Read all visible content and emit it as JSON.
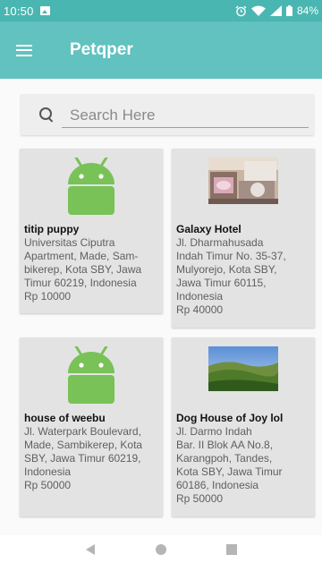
{
  "status_bar": {
    "time": "10:50",
    "battery": "84%"
  },
  "app_bar": {
    "title": "Petqper"
  },
  "search": {
    "placeholder": "Search Here"
  },
  "listings": [
    {
      "name": "titip puppy",
      "address": "Universitas Ciputra Apartment, Made, Sambikerep, Kota SBY, Jawa Timur 60219, Indonesia",
      "address_lines": [
        "Universitas Ciputra",
        "Apartment, Made, Sam-",
        "bikerep, Kota SBY, Jawa",
        "Timur 60219, Indonesia"
      ],
      "price": "Rp 10000",
      "image": "android-placeholder-icon"
    },
    {
      "name": "Galaxy Hotel",
      "address": "Jl. Dharmahusada Indah Timur No. 35-37, Mulyorejo, Kota SBY, Jawa Timur 60115, Indonesia",
      "address_lines": [
        "Jl. Dharmahusada",
        "Indah Timur No. 35-37,",
        "Mulyorejo, Kota SBY,",
        "Jawa Timur 60115,",
        "Indonesia"
      ],
      "price": "Rp 40000",
      "image": "pet-room-photo"
    },
    {
      "name": "house of weebu",
      "address": "Jl. Waterpark Boulevard, Made, Sambikerep, Kota SBY, Jawa Timur 60219, Indonesia",
      "address_lines": [
        "Jl. Waterpark Boulevard,",
        "Made, Sambikerep, Kota",
        "SBY, Jawa Timur 60219,",
        "Indonesia"
      ],
      "price": "Rp 50000",
      "image": "android-placeholder-icon"
    },
    {
      "name": "Dog House of Joy lol",
      "address": "Jl. Darmo Indah Bar. II Blok AA No.8, Karangpoh, Tandes, Kota SBY, Jawa Timur 60186, Indonesia",
      "address_lines": [
        "Jl. Darmo Indah",
        "Bar. II Blok AA No.8,",
        "Karangpoh, Tandes,",
        "Kota SBY, Jawa Timur",
        "60186, Indonesia"
      ],
      "price": "Rp 50000",
      "image": "landscape-photo"
    }
  ],
  "colors": {
    "status_bar": "#4ab6b1",
    "app_bar": "#62c2bf",
    "card_bg": "#e3e3e3",
    "android_green": "#78c257"
  }
}
